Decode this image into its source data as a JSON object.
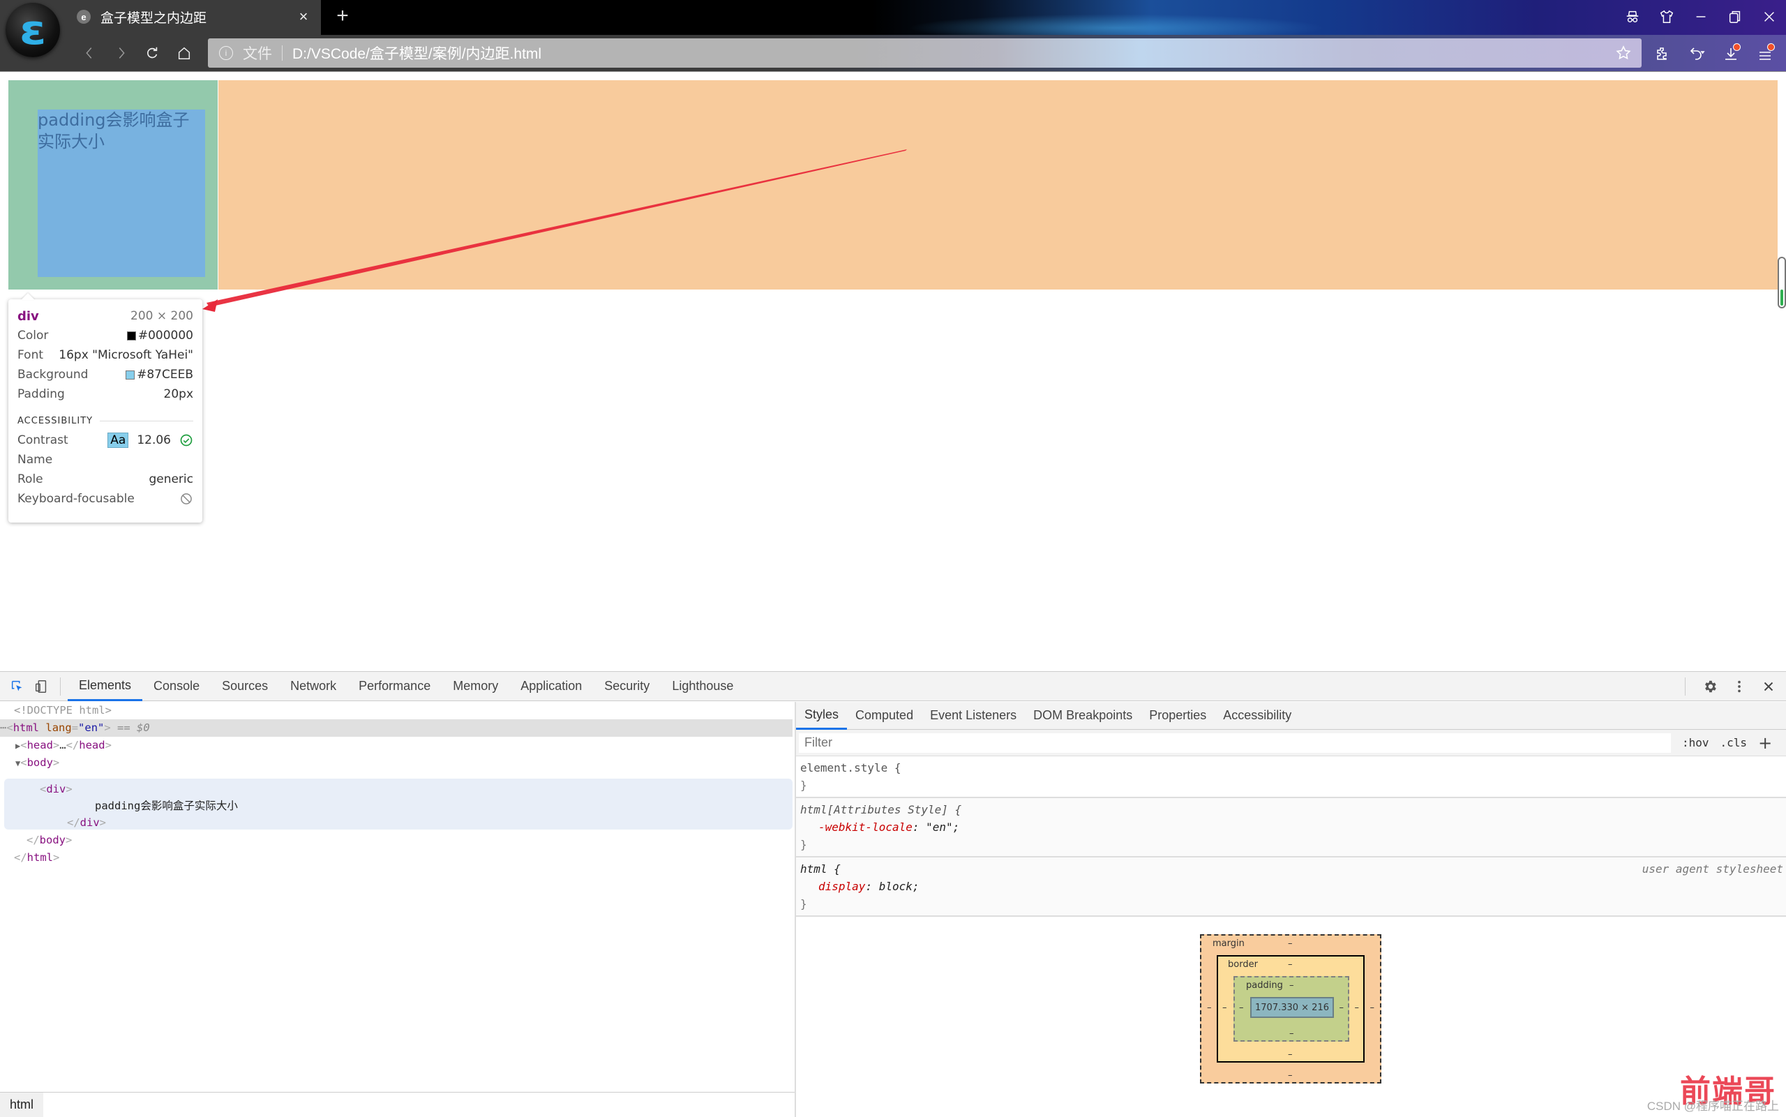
{
  "browser": {
    "tab": {
      "title": "盒子模型之内边距",
      "favicon": "e",
      "close": "×"
    },
    "new_tab": "+",
    "address": {
      "file_label": "文件",
      "url": "D:/VSCode/盒子模型/案例/内边距.html"
    },
    "window_controls": [
      "incognito-icon",
      "skin-icon",
      "minimize-icon",
      "restore-icon",
      "close-icon"
    ],
    "toolbar_icons": [
      "extensions-icon",
      "undo-icon",
      "download-icon",
      "menu-icon"
    ]
  },
  "page": {
    "box_text": "padding会影响盒子实际大小",
    "colors": {
      "outer": "#F8CB9C",
      "padding": "#93C9AC",
      "content": "#87CEEB",
      "arrow": "#E8293A"
    },
    "scroll_progress": 0.35
  },
  "tooltip": {
    "tag": "div",
    "size": "200 × 200",
    "rows": [
      {
        "label": "Color",
        "value": "#000000",
        "swatch": "#000000"
      },
      {
        "label": "Font",
        "value": "16px \"Microsoft YaHei\""
      },
      {
        "label": "Background",
        "value": "#87CEEB",
        "swatch": "#87CEEB"
      },
      {
        "label": "Padding",
        "value": "20px"
      }
    ],
    "accessibility_header": "ACCESSIBILITY",
    "accessibility": {
      "contrast_label": "Contrast",
      "contrast_chip": "Aa",
      "contrast_value": "12.06",
      "name_label": "Name",
      "role_label": "Role",
      "role_value": "generic",
      "focusable_label": "Keyboard-focusable"
    }
  },
  "devtools": {
    "tabs": [
      "Elements",
      "Console",
      "Sources",
      "Network",
      "Performance",
      "Memory",
      "Application",
      "Security",
      "Lighthouse"
    ],
    "active_tab": "Elements",
    "dom": {
      "doctype": "<!DOCTYPE html>",
      "html_open_tag": "html",
      "html_attr_name": "lang",
      "html_attr_value": "\"en\"",
      "selected_marker": "== $0",
      "head": "head",
      "head_ellipsis": "…",
      "body": "body",
      "div": "div",
      "div_text": "padding会影响盒子实际大小"
    },
    "breadcrumb": "html",
    "styles_tabs": [
      "Styles",
      "Computed",
      "Event Listeners",
      "DOM Breakpoints",
      "Properties",
      "Accessibility"
    ],
    "active_styles_tab": "Styles",
    "filter_placeholder": "Filter",
    "filter_buttons": {
      "hov": ":hov",
      "cls": ".cls",
      "add": "+"
    },
    "rules": [
      {
        "selector": "element.style {",
        "declarations": []
      },
      {
        "selector": "html[Attributes Style] {",
        "declarations": [
          {
            "prop": "-webkit-locale",
            "value": "\"en\";"
          }
        ]
      },
      {
        "selector": "html {",
        "origin": "user agent stylesheet",
        "declarations": [
          {
            "prop": "display",
            "value": "block;"
          }
        ]
      }
    ],
    "box_model": {
      "margin_label": "margin",
      "border_label": "border",
      "padding_label": "padding",
      "content_size": "1707.330 × 216",
      "dash": "–"
    }
  },
  "watermark": {
    "text": "CSDN @程序喵正在路上",
    "stamp": "前端哥"
  }
}
